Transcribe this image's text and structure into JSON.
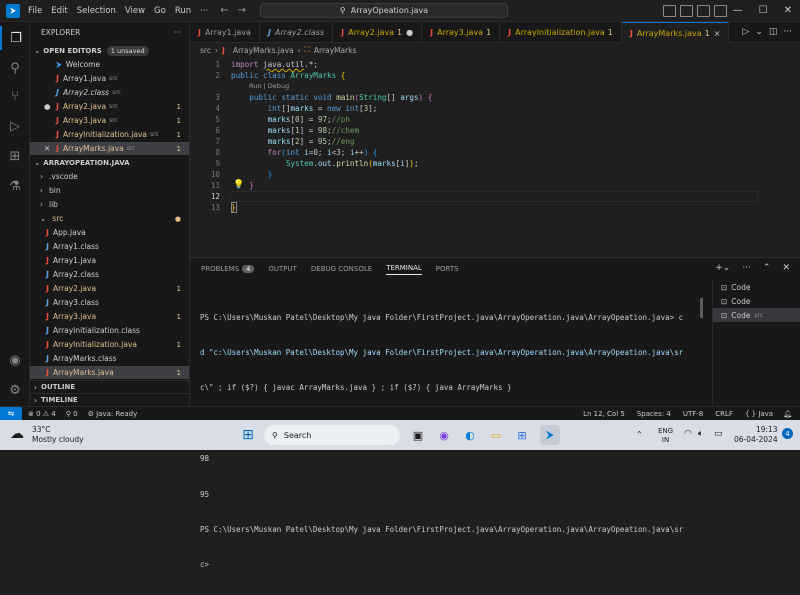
{
  "titlebar": {
    "menu": [
      "File",
      "Edit",
      "Selection",
      "View",
      "Go",
      "Run",
      "···"
    ],
    "search_text": "ArrayOpeation.java"
  },
  "explorer": {
    "title": "EXPLORER",
    "open_editors_label": "OPEN EDITORS",
    "unsaved_label": "1 unsaved",
    "open_editors": [
      {
        "name": "Welcome",
        "icon": "vscode-icon",
        "src": "",
        "count": "",
        "prefix": ""
      },
      {
        "name": "Array1.java",
        "icon": "java-icon",
        "src": "src",
        "count": "",
        "prefix": ""
      },
      {
        "name": "Array2.class",
        "icon": "class-icon",
        "src": "src",
        "count": "",
        "prefix": ""
      },
      {
        "name": "Array2.java",
        "icon": "java-icon",
        "src": "src",
        "count": "1",
        "prefix": "●"
      },
      {
        "name": "Array3.java",
        "icon": "java-icon",
        "src": "src",
        "count": "1",
        "prefix": ""
      },
      {
        "name": "ArrayInitialization.java",
        "icon": "java-icon",
        "src": "src",
        "count": "1",
        "prefix": ""
      },
      {
        "name": "ArrayMarks.java",
        "icon": "java-icon",
        "src": "src",
        "count": "1",
        "prefix": "✕"
      }
    ],
    "project_label": "ARRAYOPEATION.JAVA",
    "tree": [
      {
        "name": ".vscode",
        "type": "folder"
      },
      {
        "name": "bin",
        "type": "folder"
      },
      {
        "name": "lib",
        "type": "folder"
      },
      {
        "name": "src",
        "type": "folder-open"
      }
    ],
    "src_files": [
      {
        "name": "App.java",
        "icon": "java-icon",
        "count": ""
      },
      {
        "name": "Array1.class",
        "icon": "class-icon",
        "count": ""
      },
      {
        "name": "Array1.java",
        "icon": "java-icon",
        "count": ""
      },
      {
        "name": "Array2.class",
        "icon": "class-icon",
        "count": ""
      },
      {
        "name": "Array2.java",
        "icon": "java-icon",
        "count": "1"
      },
      {
        "name": "Array3.class",
        "icon": "class-icon",
        "count": ""
      },
      {
        "name": "Array3.java",
        "icon": "java-icon",
        "count": "1"
      },
      {
        "name": "ArrayInitialization.class",
        "icon": "class-icon",
        "count": ""
      },
      {
        "name": "ArrayInitialization.java",
        "icon": "java-icon",
        "count": "1"
      },
      {
        "name": "ArrayMarks.class",
        "icon": "class-icon",
        "count": ""
      },
      {
        "name": "ArrayMarks.java",
        "icon": "java-icon",
        "count": "1"
      }
    ],
    "outline_label": "OUTLINE",
    "timeline_label": "TIMELINE"
  },
  "tabs": [
    {
      "label": "Array1.java",
      "italic": false,
      "suffix": "",
      "count": ""
    },
    {
      "label": "Array2.class",
      "italic": true,
      "suffix": "",
      "count": ""
    },
    {
      "label": "Array2.java",
      "italic": false,
      "suffix": "1",
      "count": "●"
    },
    {
      "label": "Array3.java",
      "italic": false,
      "suffix": "1",
      "count": ""
    },
    {
      "label": "ArrayInitialization.java",
      "italic": false,
      "suffix": "1",
      "count": ""
    },
    {
      "label": "ArrayMarks.java",
      "italic": false,
      "suffix": "1",
      "count": "×"
    }
  ],
  "breadcrumb": {
    "folder": "src",
    "file": "ArrayMarks.java",
    "symbol": "ArrayMarks"
  },
  "editor": {
    "codelens": "Run | Debug",
    "lines": [
      "1",
      "2",
      "3",
      "4",
      "5",
      "6",
      "7",
      "8",
      "9",
      "10",
      "11",
      "12",
      "13"
    ]
  },
  "panel": {
    "tabs": [
      "PROBLEMS",
      "OUTPUT",
      "DEBUG CONSOLE",
      "TERMINAL",
      "PORTS"
    ],
    "problems_count": "4",
    "terminal_lines": [
      "PS C:\\Users\\Muskan Patel\\Desktop\\My java Folder\\FirstProject.java\\ArrayOperation.java\\ArrayOpeation.java> c",
      "d \"c:\\Users\\Muskan Patel\\Desktop\\My java Folder\\FirstProject.java\\ArrayOperation.java\\ArrayOpeation.java\\sr",
      "c\\\" ; if ($?) { javac ArrayMarks.java } ; if ($?) { java ArrayMarks }",
      "97",
      "98",
      "95",
      "PS C:\\Users\\Muskan Patel\\Desktop\\My java Folder\\FirstProject.java\\ArrayOperation.java\\ArrayOpeation.java\\sr",
      "c>"
    ],
    "terminal_list": [
      {
        "label": "Code",
        "src": ""
      },
      {
        "label": "Code",
        "src": ""
      },
      {
        "label": "Code",
        "src": "src"
      }
    ]
  },
  "status": {
    "errors": "0",
    "warnings": "4",
    "ports": "0",
    "java": "Java: Ready",
    "position": "Ln 12, Col 5",
    "spaces": "Spaces: 4",
    "encoding": "UTF-8",
    "eol": "CRLF",
    "language": "Java"
  },
  "taskbar": {
    "temp": "33°C",
    "weather": "Mostly cloudy",
    "search": "Search",
    "lang": "ENG",
    "region": "IN",
    "time": "19:13",
    "date": "06-04-2024"
  }
}
